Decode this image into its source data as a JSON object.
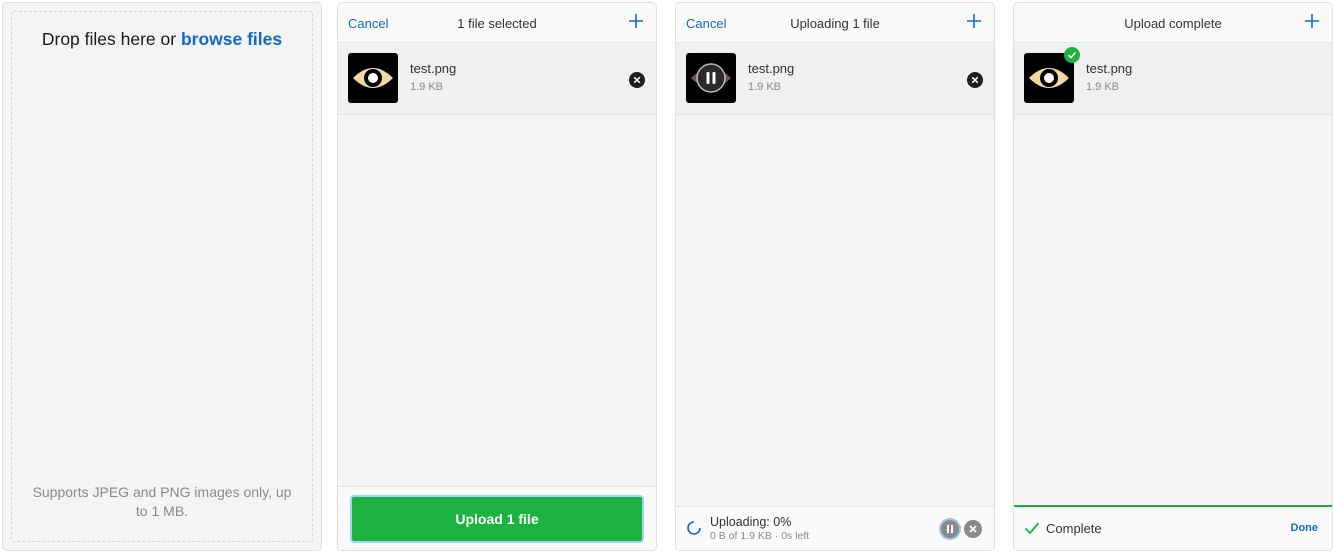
{
  "panel1": {
    "drop_text": "Drop files here or",
    "browse_text": "browse files",
    "note": "Supports JPEG and PNG images only, up to 1 MB."
  },
  "panel2": {
    "cancel": "Cancel",
    "title": "1 file selected",
    "file": {
      "name": "test.png",
      "size": "1.9 KB"
    },
    "upload_button": "Upload 1 file"
  },
  "panel3": {
    "cancel": "Cancel",
    "title": "Uploading 1 file",
    "file": {
      "name": "test.png",
      "size": "1.9 KB"
    },
    "status": "Uploading: 0%",
    "detail": "0 B of 1.9 KB · 0s left",
    "progress_percent": 0
  },
  "panel4": {
    "title": "Upload complete",
    "file": {
      "name": "test.png",
      "size": "1.9 KB"
    },
    "status": "Complete",
    "done": "Done"
  },
  "icons": {
    "plus": "plus-icon",
    "remove": "close-circle-icon",
    "pause": "pause-icon",
    "check": "check-icon",
    "spinner": "spinner-icon"
  },
  "colors": {
    "accent": "#1269cf",
    "success": "#1bb240",
    "panel_bg": "#f4f4f4",
    "muted_text": "#8a8a8a"
  }
}
